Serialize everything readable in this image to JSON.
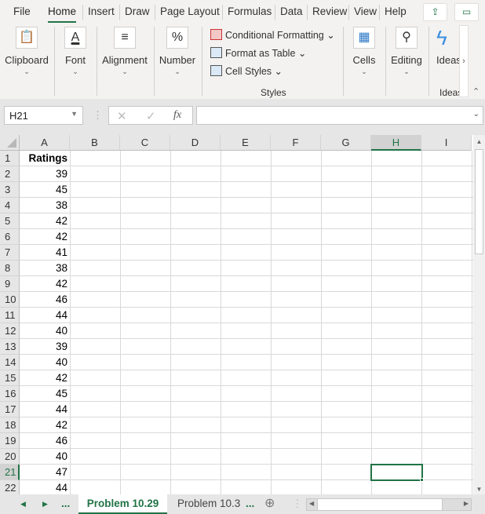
{
  "menu": {
    "items": [
      "File",
      "Home",
      "Insert",
      "Draw",
      "Page Layout",
      "Formulas",
      "Data",
      "Review",
      "View",
      "Help"
    ],
    "active": "Home"
  },
  "ribbon": {
    "clipboard": "Clipboard",
    "font": "Font",
    "alignment": "Alignment",
    "number": "Number",
    "conditional_formatting": "Conditional Formatting",
    "format_as_table": "Format as Table",
    "cell_styles": "Cell Styles",
    "styles": "Styles",
    "cells": "Cells",
    "editing": "Editing",
    "ideas": "Ideas",
    "ideas_group": "Ideas"
  },
  "formula_bar": {
    "name_box": "H21",
    "formula": "",
    "fx": "fx"
  },
  "columns": [
    "A",
    "B",
    "C",
    "D",
    "E",
    "F",
    "G",
    "H",
    "I"
  ],
  "selected_column": "H",
  "selected_row": 21,
  "rows": [
    {
      "n": "1",
      "a": "Ratings"
    },
    {
      "n": "2",
      "a": "39"
    },
    {
      "n": "3",
      "a": "45"
    },
    {
      "n": "4",
      "a": "38"
    },
    {
      "n": "5",
      "a": "42"
    },
    {
      "n": "6",
      "a": "42"
    },
    {
      "n": "7",
      "a": "41"
    },
    {
      "n": "8",
      "a": "38"
    },
    {
      "n": "9",
      "a": "42"
    },
    {
      "n": "10",
      "a": "46"
    },
    {
      "n": "11",
      "a": "44"
    },
    {
      "n": "12",
      "a": "40"
    },
    {
      "n": "13",
      "a": "39"
    },
    {
      "n": "14",
      "a": "40"
    },
    {
      "n": "15",
      "a": "42"
    },
    {
      "n": "16",
      "a": "45"
    },
    {
      "n": "17",
      "a": "44"
    },
    {
      "n": "18",
      "a": "42"
    },
    {
      "n": "19",
      "a": "46"
    },
    {
      "n": "20",
      "a": "40"
    },
    {
      "n": "21",
      "a": "47"
    },
    {
      "n": "22",
      "a": "44"
    }
  ],
  "sheets": {
    "active": "Problem 10.29",
    "other": "Problem 10.3",
    "ellipsis": "..."
  },
  "colors": {
    "accent": "#217346"
  }
}
